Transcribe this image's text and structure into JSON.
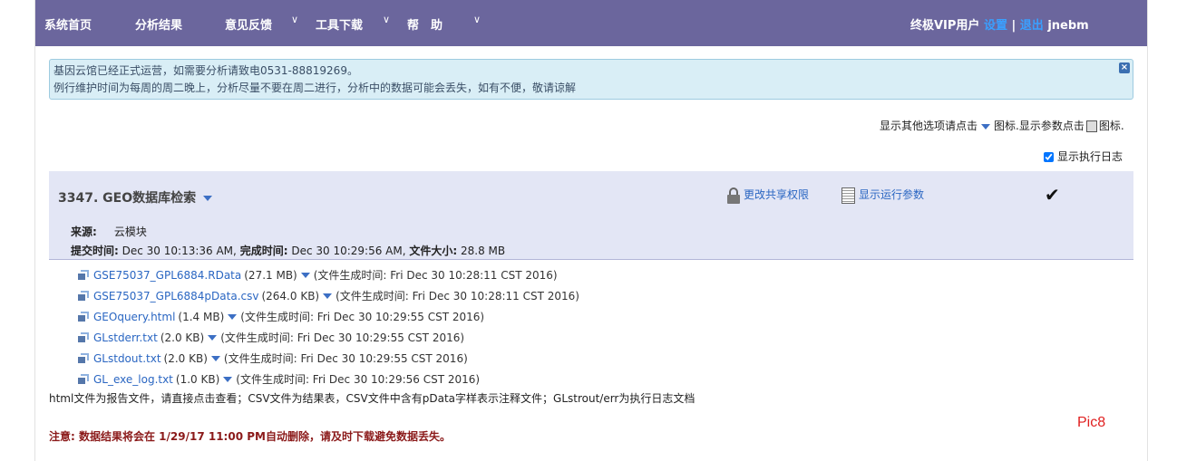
{
  "nav": {
    "items": [
      {
        "label": "系统首页"
      },
      {
        "label": "分析结果"
      },
      {
        "label": "意见反馈"
      },
      {
        "label": "工具下载"
      },
      {
        "label": "帮　助"
      }
    ],
    "user_type": "终极VIP用户",
    "settings_link": "设置",
    "separator": "|",
    "logout_link": "退出",
    "username": "jnebm"
  },
  "notice": {
    "line1": "基因云馆已经正式运营，如需要分析请致电0531-88819269。",
    "line2": "例行维护时间为每周的周二晚上，分析尽量不要在周二进行，分析中的数据可能会丢失，如有不便，敬请谅解",
    "close_symbol": "×"
  },
  "options": {
    "text1": "显示其他选项请点击",
    "text2": "图标.显示参数点击",
    "text3": "图标."
  },
  "log_checkbox": {
    "label": "显示执行日志",
    "checked": true
  },
  "job": {
    "title": "3347. GEO数据库检索",
    "share_action": "更改共享权限",
    "params_action": "显示运行参数",
    "check_symbol": "✔",
    "source_label": "来源:",
    "source_value": "云模块",
    "submit_label": "提交时间:",
    "submit_value": "Dec 30 10:13:36 AM,",
    "finish_label": "完成时间:",
    "finish_value": "Dec 30 10:29:56 AM,",
    "size_label": "文件大小:",
    "size_value": "28.8 MB"
  },
  "files": [
    {
      "name": "GSE75037_GPL6884.RData",
      "size": "(27.1 MB)",
      "time": "(文件生成时间: Fri Dec 30 10:28:11 CST 2016)"
    },
    {
      "name": "GSE75037_GPL6884pData.csv",
      "size": "(264.0 KB)",
      "time": "(文件生成时间: Fri Dec 30 10:28:11 CST 2016)"
    },
    {
      "name": "GEOquery.html",
      "size": "(1.4 MB)",
      "time": "(文件生成时间: Fri Dec 30 10:29:55 CST 2016)"
    },
    {
      "name": "GLstderr.txt",
      "size": "(2.0 KB)",
      "time": "(文件生成时间: Fri Dec 30 10:29:55 CST 2016)"
    },
    {
      "name": "GLstdout.txt",
      "size": "(2.0 KB)",
      "time": "(文件生成时间: Fri Dec 30 10:29:55 CST 2016)"
    },
    {
      "name": "GL_exe_log.txt",
      "size": "(1.0 KB)",
      "time": "(文件生成时间: Fri Dec 30 10:29:56 CST 2016)"
    }
  ],
  "footer_note": "html文件为报告文件，请直接点击查看；CSV文件为结果表，CSV文件中含有pData字样表示注释文件；GLstrout/err为执行日志文档",
  "warning": "注意: 数据结果将会在 1/29/17 11:00 PM自动删除，请及时下载避免数据丢失。",
  "pic_label": "Pic8",
  "colors": {
    "nav_bg": "#6b669d",
    "notice_bg": "#d9eef6",
    "panel_bg": "#e3e6f5",
    "link": "#2a66c2",
    "warning": "#8b1a1a",
    "pic": "#e02020"
  }
}
